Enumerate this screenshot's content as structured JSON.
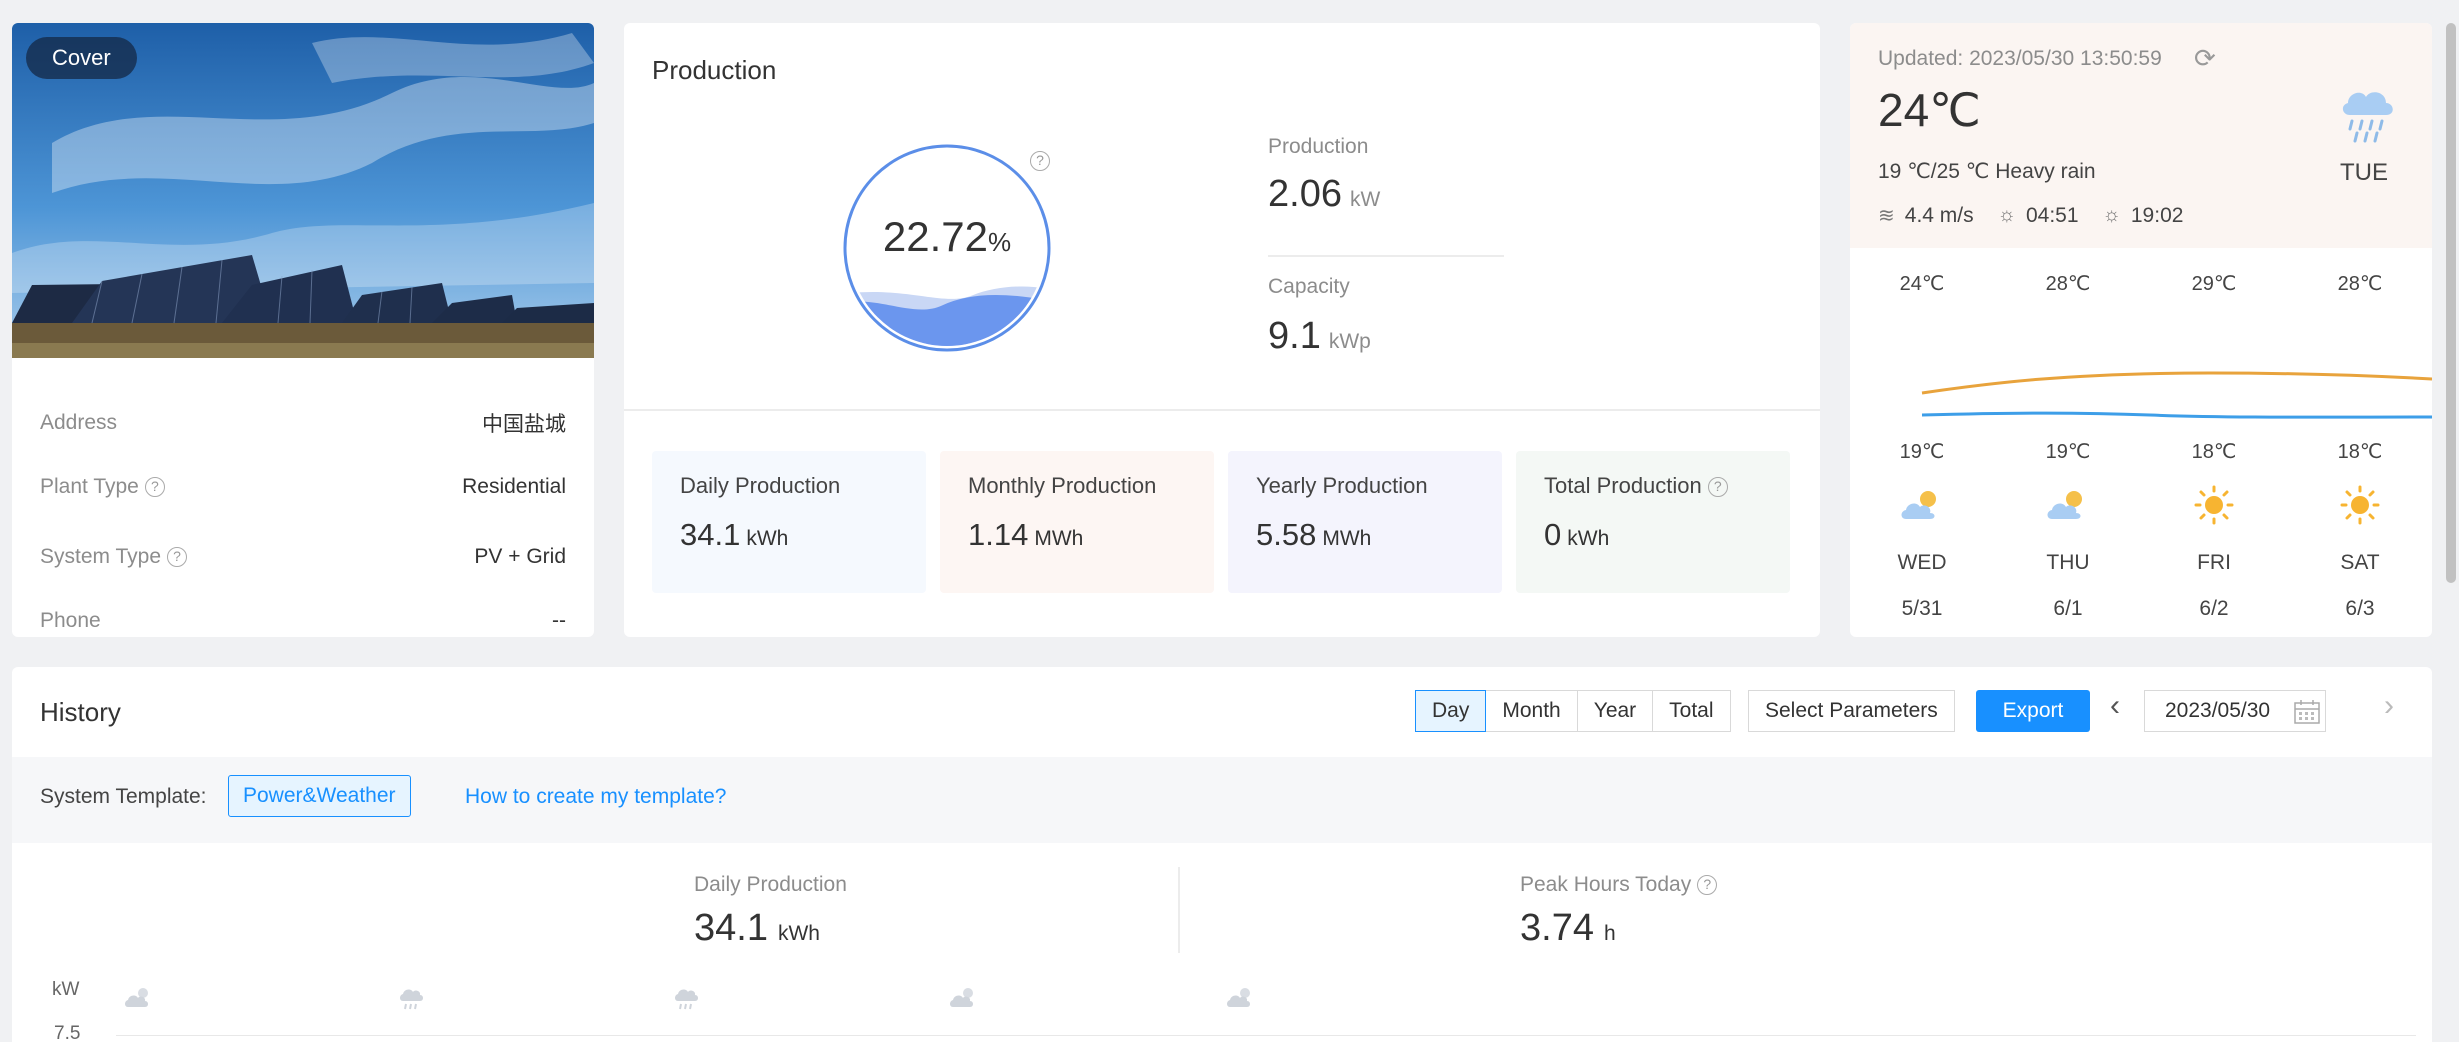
{
  "plant": {
    "cover_label": "Cover",
    "rows": [
      {
        "key": "Address",
        "value": "中国盐城"
      },
      {
        "key": "Plant Type",
        "value": "Residential"
      },
      {
        "key": "System Type",
        "value": "PV + Grid"
      },
      {
        "key": "Phone",
        "value": "--"
      }
    ]
  },
  "production": {
    "title": "Production",
    "gauge": {
      "value": "22.72",
      "unit": "%",
      "fill_fraction": 0.2272
    },
    "current": {
      "label": "Production",
      "value": "2.06",
      "unit": "kW"
    },
    "capacity": {
      "label": "Capacity",
      "value": "9.1",
      "unit": "kWp"
    },
    "stats": [
      {
        "label": "Daily Production",
        "value": "34.1",
        "unit": "kWh",
        "bg": "#f5f9fe"
      },
      {
        "label": "Monthly Production",
        "value": "1.14",
        "unit": "MWh",
        "bg": "#fdf6f3"
      },
      {
        "label": "Yearly Production",
        "value": "5.58",
        "unit": "MWh",
        "bg": "#f4f4fd"
      },
      {
        "label": "Total Production",
        "value": "0",
        "unit": "kWh",
        "bg": "#f4f8f5"
      }
    ]
  },
  "weather": {
    "updated_label": "Updated:",
    "updated_time": "2023/05/30 13:50:59",
    "temp": "24℃",
    "desc": "19 ℃/25 ℃ Heavy rain",
    "wind": "4.4 m/s",
    "sunrise": "04:51",
    "sunset": "19:02",
    "today": "TUE",
    "forecast": [
      {
        "high": "24℃",
        "low": "19℃",
        "day": "WED",
        "date": "5/31",
        "icon": "partly-cloudy"
      },
      {
        "high": "28℃",
        "low": "19℃",
        "day": "THU",
        "date": "6/1",
        "icon": "partly-cloudy"
      },
      {
        "high": "29℃",
        "low": "18℃",
        "day": "FRI",
        "date": "6/2",
        "icon": "sunny"
      },
      {
        "high": "28℃",
        "low": "18℃",
        "day": "SAT",
        "date": "6/3",
        "icon": "sunny"
      }
    ],
    "colors": {
      "high_line": "#e8a33c",
      "low_line": "#3d9ee8"
    }
  },
  "history": {
    "title": "History",
    "ranges": [
      "Day",
      "Month",
      "Year",
      "Total"
    ],
    "active_range": "Day",
    "select_params": "Select Parameters",
    "export": "Export",
    "date": "2023/05/30",
    "template_label": "System Template:",
    "template_tag": "Power&Weather",
    "template_help": "How to create my template?",
    "daily": {
      "label": "Daily Production",
      "value": "34.1",
      "unit": "kWh"
    },
    "peak": {
      "label": "Peak Hours Today",
      "value": "3.74",
      "unit": "h"
    },
    "y_unit": "kW",
    "y_tick": "7.5"
  },
  "colors": {
    "accent": "#1890ff"
  }
}
